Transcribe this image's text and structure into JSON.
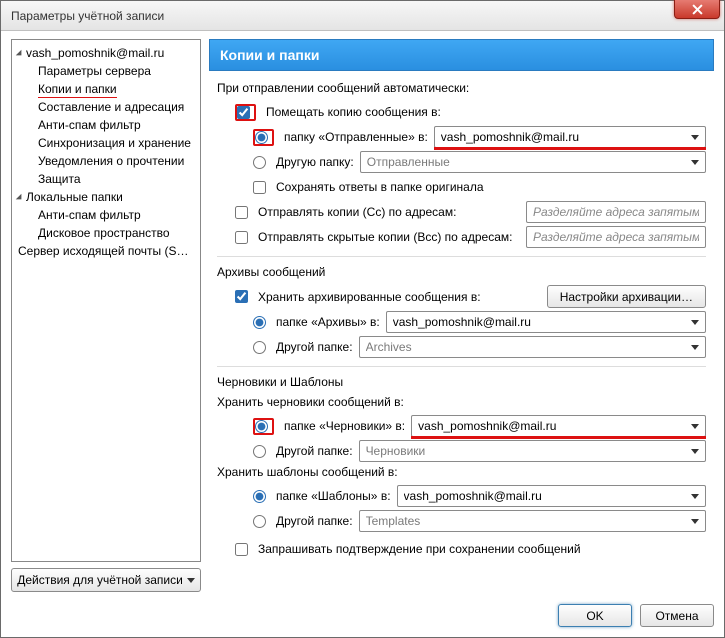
{
  "window": {
    "title": "Параметры учётной записи"
  },
  "tree": {
    "account": "vash_pomoshnik@mail.ru",
    "items": [
      "Параметры сервера",
      "Копии и папки",
      "Составление и адресация",
      "Анти-спам фильтр",
      "Синхронизация и хранение",
      "Уведомления о прочтении",
      "Защита"
    ],
    "local_header": "Локальные папки",
    "local_items": [
      "Анти-спам фильтр",
      "Дисковое пространство"
    ],
    "smtp": "Сервер исходящей почты (S…"
  },
  "account_actions": "Действия для учётной записи",
  "panel": {
    "title": "Копии и папки",
    "sending_header": "При отправлении сообщений автоматически:",
    "place_copy": "Помещать копию сообщения в:",
    "sent_folder_radio": "папку «Отправленные» в:",
    "sent_account": "vash_pomoshnik@mail.ru",
    "other_folder_radio": "Другую папку:",
    "other_sent_value": "Отправленные",
    "save_replies": "Сохранять ответы в папке оригинала",
    "cc_label": "Отправлять копии (Cc) по адресам:",
    "bcc_label": "Отправлять скрытые копии (Bcc) по адресам:",
    "addr_placeholder": "Разделяйте адреса запятыми",
    "archives_header": "Архивы сообщений",
    "keep_archives": "Хранить архивированные сообщения в:",
    "archive_settings_btn": "Настройки архивации…",
    "archive_folder_radio": "папке «Архивы» в:",
    "archive_account": "vash_pomoshnik@mail.ru",
    "archive_other_radio": "Другой папке:",
    "archive_other_value": "Archives",
    "drafts_templates_header": "Черновики и Шаблоны",
    "drafts_header": "Хранить черновики сообщений в:",
    "drafts_folder_radio": "папке «Черновики» в:",
    "drafts_account": "vash_pomoshnik@mail.ru",
    "drafts_other_radio": "Другой папке:",
    "drafts_other_value": "Черновики",
    "templates_header": "Хранить шаблоны сообщений в:",
    "templates_folder_radio": "папке «Шаблоны» в:",
    "templates_account": "vash_pomoshnik@mail.ru",
    "templates_other_radio": "Другой папке:",
    "templates_other_value": "Templates",
    "confirm_save": "Запрашивать подтверждение при сохранении сообщений"
  },
  "buttons": {
    "ok": "OK",
    "cancel": "Отмена"
  }
}
